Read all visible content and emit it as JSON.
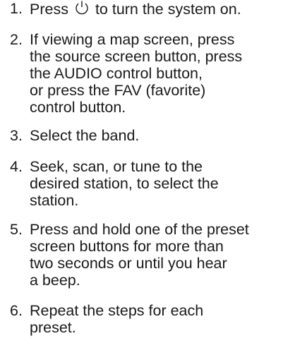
{
  "steps": [
    {
      "number": "1.",
      "before_icon": "Press",
      "icon": "power-icon",
      "after_icon": "to turn the system on."
    },
    {
      "number": "2.",
      "lines": [
        "If viewing a map screen, press",
        "the source screen button, press",
        "the AUDIO control button,",
        "or press the FAV (favorite)",
        "control button."
      ]
    },
    {
      "number": "3.",
      "lines": [
        "Select the band."
      ]
    },
    {
      "number": "4.",
      "lines": [
        "Seek, scan, or tune to the",
        "desired station, to select the",
        "station."
      ]
    },
    {
      "number": "5.",
      "lines": [
        "Press and hold one of the preset",
        "screen buttons for more than",
        "two seconds or until you hear",
        "a beep."
      ]
    },
    {
      "number": "6.",
      "lines": [
        "Repeat the steps for each",
        "preset."
      ]
    }
  ]
}
